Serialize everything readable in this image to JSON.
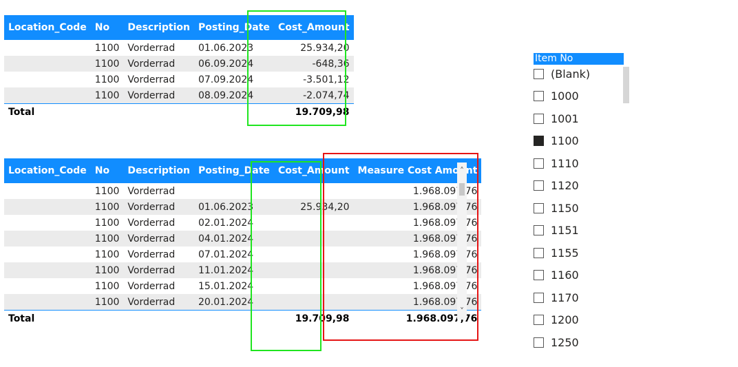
{
  "columns1": [
    "Location_Code",
    "No",
    "Description",
    "Posting_Date",
    "Cost_Amount"
  ],
  "table1": {
    "rows": [
      {
        "no": "1100",
        "desc": "Vorderrad",
        "date": "01.06.2023",
        "cost": "25.934,20"
      },
      {
        "no": "1100",
        "desc": "Vorderrad",
        "date": "06.09.2024",
        "cost": "-648,36"
      },
      {
        "no": "1100",
        "desc": "Vorderrad",
        "date": "07.09.2024",
        "cost": "-3.501,12"
      },
      {
        "no": "1100",
        "desc": "Vorderrad",
        "date": "08.09.2024",
        "cost": "-2.074,74"
      }
    ],
    "total_label": "Total",
    "total_cost": "19.709,98"
  },
  "columns2": [
    "Location_Code",
    "No",
    "Description",
    "Posting_Date",
    "Cost_Amount",
    "Measure Cost Amount"
  ],
  "table2": {
    "rows": [
      {
        "no": "1100",
        "desc": "Vorderrad",
        "date": "",
        "cost": "",
        "measure": "1.968.097,76"
      },
      {
        "no": "1100",
        "desc": "Vorderrad",
        "date": "01.06.2023",
        "cost": "25.934,20",
        "measure": "1.968.097,76"
      },
      {
        "no": "1100",
        "desc": "Vorderrad",
        "date": "02.01.2024",
        "cost": "",
        "measure": "1.968.097,76"
      },
      {
        "no": "1100",
        "desc": "Vorderrad",
        "date": "04.01.2024",
        "cost": "",
        "measure": "1.968.097,76"
      },
      {
        "no": "1100",
        "desc": "Vorderrad",
        "date": "07.01.2024",
        "cost": "",
        "measure": "1.968.097,76"
      },
      {
        "no": "1100",
        "desc": "Vorderrad",
        "date": "11.01.2024",
        "cost": "",
        "measure": "1.968.097,76"
      },
      {
        "no": "1100",
        "desc": "Vorderrad",
        "date": "15.01.2024",
        "cost": "",
        "measure": "1.968.097,76"
      },
      {
        "no": "1100",
        "desc": "Vorderrad",
        "date": "20.01.2024",
        "cost": "",
        "measure": "1.968.097,76"
      }
    ],
    "total_label": "Total",
    "total_cost": "19.709,98",
    "total_measure": "1.968.097,76"
  },
  "slicer": {
    "title": "Item No",
    "items": [
      {
        "label": "(Blank)",
        "checked": false
      },
      {
        "label": "1000",
        "checked": false
      },
      {
        "label": "1001",
        "checked": false
      },
      {
        "label": "1100",
        "checked": true
      },
      {
        "label": "1110",
        "checked": false
      },
      {
        "label": "1120",
        "checked": false
      },
      {
        "label": "1150",
        "checked": false
      },
      {
        "label": "1151",
        "checked": false
      },
      {
        "label": "1155",
        "checked": false
      },
      {
        "label": "1160",
        "checked": false
      },
      {
        "label": "1170",
        "checked": false
      },
      {
        "label": "1200",
        "checked": false
      },
      {
        "label": "1250",
        "checked": false
      }
    ]
  },
  "colors": {
    "header": "#118DFF",
    "green_box": "#1FE51F",
    "red_box": "#E51414"
  },
  "icons": {
    "scroll_up": "˄",
    "scroll_down": "˅"
  }
}
